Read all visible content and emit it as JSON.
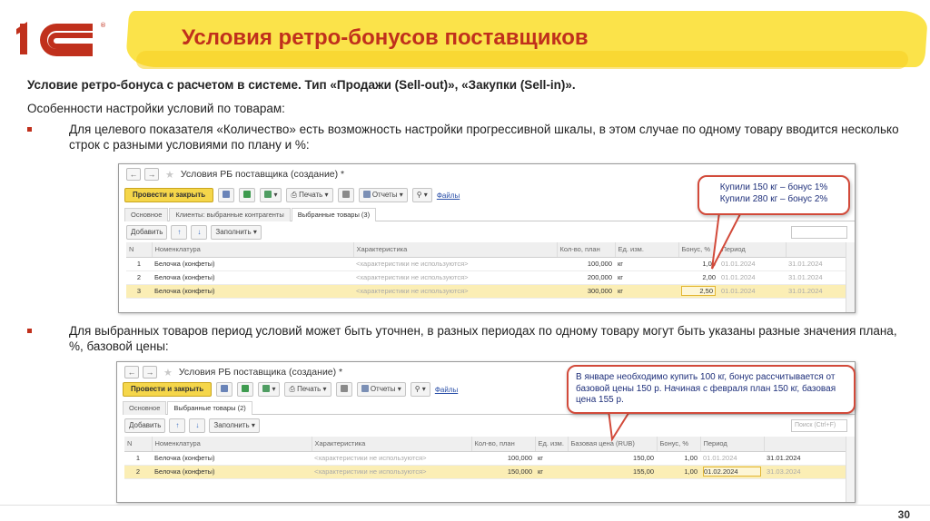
{
  "slide": {
    "title": "Условия ретро-бонусов поставщиков",
    "subtitle": "Условие ретро-бонуса с расчетом в системе. Тип «Продажи (Sell-out)», «Закупки (Sell-in)».",
    "features_heading": "Особенности настройки условий по товарам:",
    "bullets": [
      "Для целевого показателя «Количество» есть возможность настройки прогрессивной шкалы, в этом случае по одному товару вводится несколько строк с разными условиями по плану и %:",
      "Для выбранных товаров период условий может быть уточнен, в разных периодах по одному товару могут быть указаны разные значения плана, %, базовой цены:"
    ],
    "page_number": "30",
    "logo_text": "1С"
  },
  "colors": {
    "accent": "#c0301c",
    "highlight": "#fbe34a",
    "primary_button": "#f5d64a",
    "callout_border": "#d24a3a",
    "callout_text": "#1e2f7a"
  },
  "screen1": {
    "window_title": "Условия РБ поставщика (создание) *",
    "toolbar": {
      "primary": "Провести и закрыть",
      "print": "Печать",
      "reports": "Отчеты",
      "files": "Файлы"
    },
    "tabs": [
      "Основное",
      "Клиенты: выбранные контрагенты",
      "Выбранные товары (3)"
    ],
    "grid_buttons": {
      "add": "Добавить",
      "fill": "Заполнить"
    },
    "columns": [
      "N",
      "Номенклатура",
      "Характеристика",
      "Кол-во, план",
      "Ед. изм.",
      "Бонус, %",
      "Период",
      ""
    ],
    "rows": [
      {
        "n": "1",
        "item": "Белочка (конфеты)",
        "char": "<характеристики не используются>",
        "qty": "100,000",
        "unit": "кг",
        "bonus": "1,00",
        "from": "01.01.2024",
        "to": "31.01.2024"
      },
      {
        "n": "2",
        "item": "Белочка (конфеты)",
        "char": "<характеристики не используются>",
        "qty": "200,000",
        "unit": "кг",
        "bonus": "2,00",
        "from": "01.01.2024",
        "to": "31.01.2024"
      },
      {
        "n": "3",
        "item": "Белочка (конфеты)",
        "char": "<характеристики не используются>",
        "qty": "300,000",
        "unit": "кг",
        "bonus": "2,50",
        "from": "01.01.2024",
        "to": "31.01.2024"
      }
    ],
    "callout": [
      "Купили 150 кг – бонус 1%",
      "Купили 280 кг – бонус 2%"
    ]
  },
  "screen2": {
    "window_title": "Условия РБ поставщика (создание) *",
    "toolbar": {
      "primary": "Провести и закрыть",
      "print": "Печать",
      "reports": "Отчеты",
      "files": "Файлы"
    },
    "tabs": [
      "Основное",
      "Выбранные товары (2)"
    ],
    "grid_buttons": {
      "add": "Добавить",
      "fill": "Заполнить",
      "search": "Поиск (Ctrl+F)"
    },
    "columns": [
      "N",
      "Номенклатура",
      "Характеристика",
      "Кол-во, план",
      "Ед. изм.",
      "Базовая цена (RUB)",
      "Бонус, %",
      "Период",
      ""
    ],
    "rows": [
      {
        "n": "1",
        "item": "Белочка (конфеты)",
        "char": "<характеристики не используются>",
        "qty": "100,000",
        "unit": "кг",
        "price": "150,00",
        "bonus": "1,00",
        "from": "01.01.2024",
        "to": "31.01.2024"
      },
      {
        "n": "2",
        "item": "Белочка (конфеты)",
        "char": "<характеристики не используются>",
        "qty": "150,000",
        "unit": "кг",
        "price": "155,00",
        "bonus": "1,00",
        "from": "01.02.2024",
        "to": "31.03.2024"
      }
    ],
    "callout": "В январе необходимо купить 100 кг, бонус рассчитывается от базовой цены 150 р. Начиная с февраля план 150 кг, базовая цена 155 р."
  }
}
